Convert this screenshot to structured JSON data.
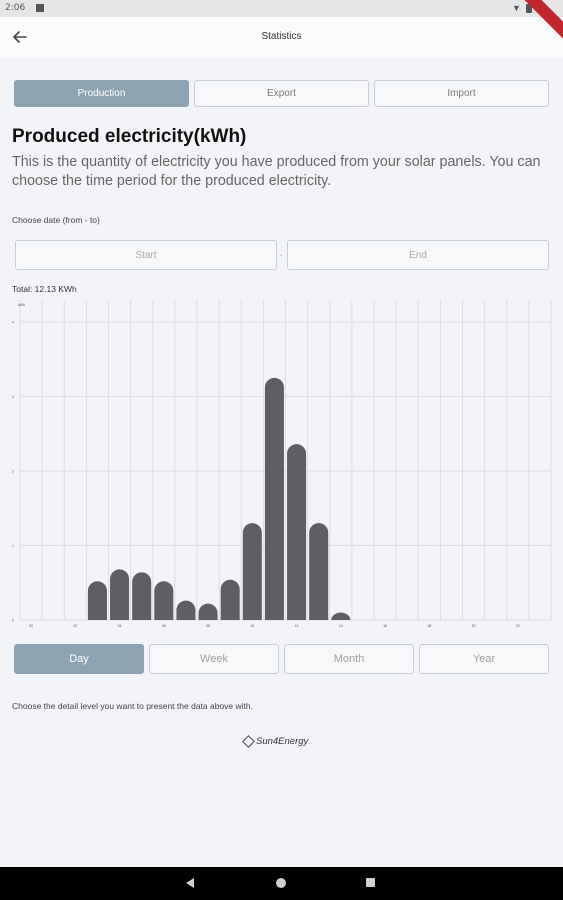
{
  "status_bar": {
    "time": "2:06"
  },
  "app_bar": {
    "title": "Statistics"
  },
  "tabs": [
    {
      "label": "Production",
      "active": true
    },
    {
      "label": "Export",
      "active": false
    },
    {
      "label": "Import",
      "active": false
    }
  ],
  "heading": "Produced electricity(kWh)",
  "description": "This is the quantity of electricity you have produced from your solar panels. You can choose the time period for the  produced electricity.",
  "date_section": {
    "label": "Choose date (from - to)",
    "start_placeholder": "Start",
    "separator": "-",
    "end_placeholder": "End"
  },
  "total": "Total: 12.13 KWh",
  "periods": [
    {
      "label": "Day",
      "active": true
    },
    {
      "label": "Week",
      "active": false
    },
    {
      "label": "Month",
      "active": false
    },
    {
      "label": "Year",
      "active": false
    }
  ],
  "detail_note": "Choose the detail level you want to present the data above with.",
  "brand": "Sun4Energy",
  "colors": {
    "accent": "#8ea3b1",
    "bar": "#5f5e63",
    "background": "#f3f4f7"
  },
  "chart_data": {
    "type": "bar",
    "unit_label": "kWh",
    "x": [
      0,
      1,
      2,
      3,
      4,
      5,
      6,
      7,
      8,
      9,
      10,
      11,
      12,
      13,
      14,
      15,
      16,
      17,
      18,
      19,
      20,
      21,
      22,
      23
    ],
    "values": [
      0,
      0,
      0,
      0.52,
      0.68,
      0.64,
      0.52,
      0.26,
      0.22,
      0.54,
      1.3,
      3.25,
      2.36,
      1.3,
      0.1,
      0,
      0,
      0,
      0,
      0,
      0,
      0,
      0,
      0
    ],
    "ylim": [
      0,
      4
    ],
    "grid": true,
    "legend": "none"
  }
}
